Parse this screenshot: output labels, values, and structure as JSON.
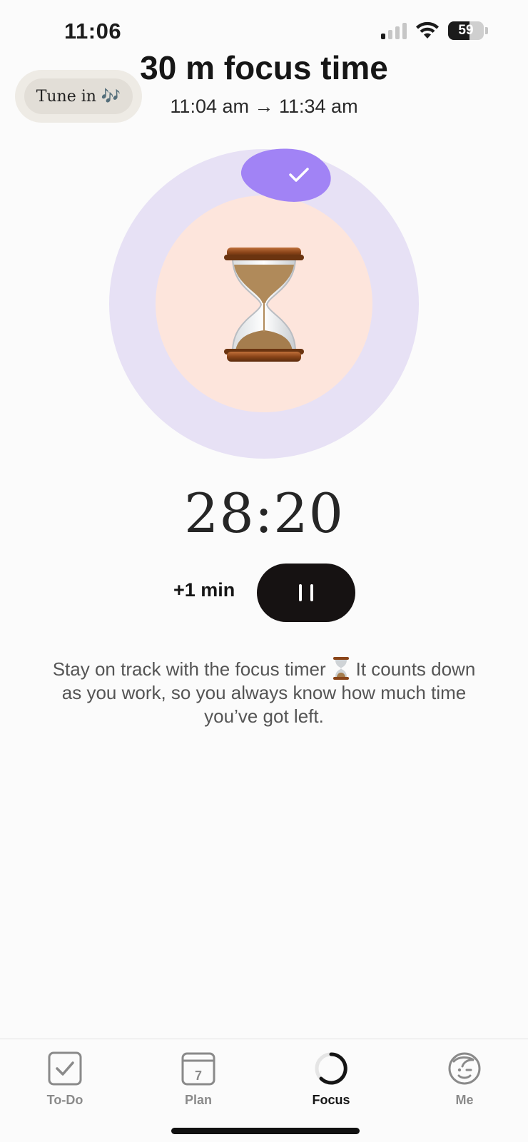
{
  "status_bar": {
    "time": "11:06",
    "battery": "59"
  },
  "tune_in": {
    "label": "Tune in 🎶"
  },
  "header": {
    "title": "30 m focus time",
    "time_range": "11:04 am → 11:34 am"
  },
  "timer": {
    "remaining": "28:20",
    "progress_fraction": 0.06
  },
  "controls": {
    "add_label": "+1 min"
  },
  "description": {
    "part1": "Stay on track with the focus timer",
    "part2": "It counts down as you work, so you always know how much time you’ve got left."
  },
  "tabs": [
    {
      "label": "To-Do",
      "icon": "checkbox-icon",
      "active": false
    },
    {
      "label": "Plan",
      "icon": "calendar-icon",
      "calendar_day": "7",
      "active": false
    },
    {
      "label": "Focus",
      "icon": "focus-ring-icon",
      "active": true
    },
    {
      "label": "Me",
      "icon": "face-icon",
      "active": false
    }
  ],
  "colors": {
    "ring_outer": "#e7e1f5",
    "ring_inner": "#fde5dc",
    "accent_purple": "#a183f5",
    "pause_bg": "#161212"
  }
}
